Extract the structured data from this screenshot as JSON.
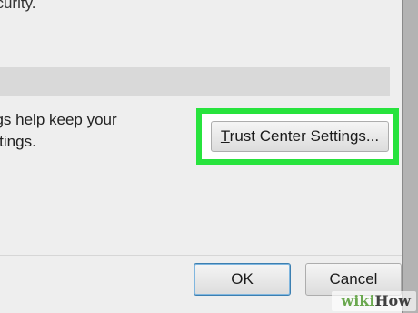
{
  "dialog": {
    "top_text": "ecurity.",
    "description_lines": [
      "ngs help keep your",
      "ettings."
    ]
  },
  "buttons": {
    "trust_center_accel": "T",
    "trust_center_rest": "rust Center Settings...",
    "ok": "OK",
    "cancel": "Cancel"
  },
  "watermark": {
    "part1": "wiki",
    "part2": "How"
  },
  "colors": {
    "highlight": "#27e33d",
    "dialog_bg": "#eeeeee",
    "section_header": "#d9d9d9",
    "ok_border": "#3c7fb1"
  }
}
